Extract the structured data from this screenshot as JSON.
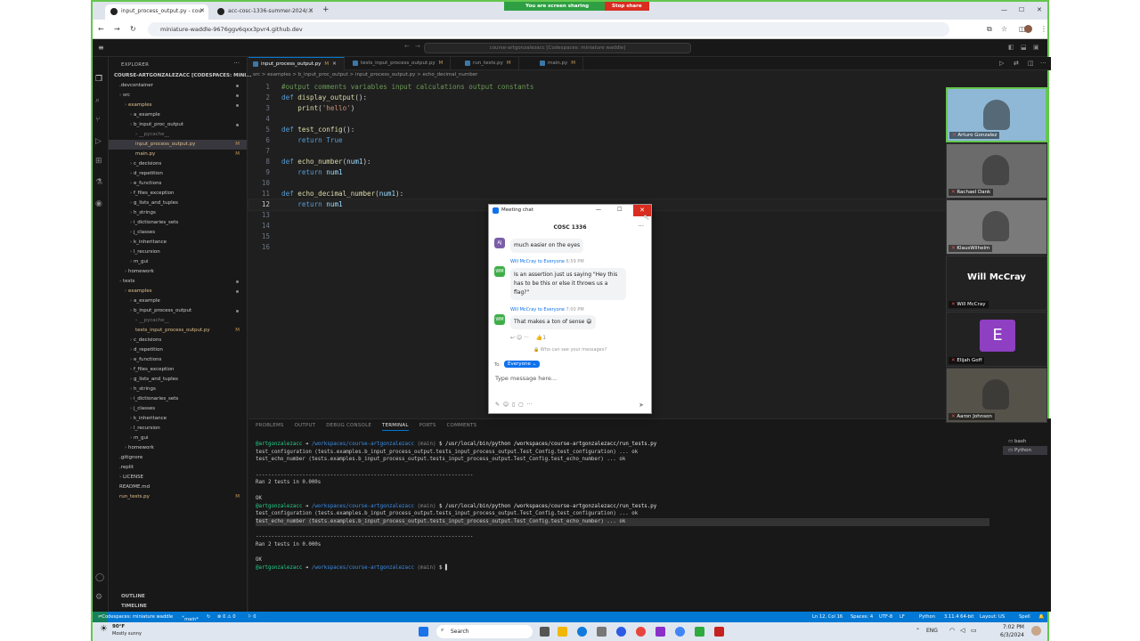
{
  "browser": {
    "tabs": [
      {
        "label": "input_process_output.py - cou",
        "active": true
      },
      {
        "label": "acc-cosc-1336-summer-2024/...",
        "active": false
      }
    ],
    "share_banner": "You are screen sharing",
    "stop_share": "Stop share",
    "url": "miniature-waddle-9676ggv6qxx3pvr4.github.dev"
  },
  "vscode": {
    "command_center": "course-artgonzalezacc [Codespaces: miniature waddle]",
    "explorer_title": "EXPLORER",
    "tree": [
      {
        "label": "COURSE-ARTGONZALEZACC [CODESPACES: MINI...",
        "indent": 0,
        "bold": true
      },
      {
        "label": ".devcontainer",
        "indent": 1,
        "dot": true
      },
      {
        "label": "src",
        "indent": 1,
        "dot": true
      },
      {
        "label": "examples",
        "indent": 2,
        "dot": true,
        "color": "#e2c08d"
      },
      {
        "label": "a_example",
        "indent": 3
      },
      {
        "label": "b_input_proc_output",
        "indent": 3,
        "dot": true
      },
      {
        "label": "__pycache__",
        "indent": 4,
        "color": "#777"
      },
      {
        "label": "input_process_output.py",
        "indent": 4,
        "mark": "M",
        "selected": true,
        "color": "#e2c08d"
      },
      {
        "label": "main.py",
        "indent": 4,
        "mark": "M",
        "color": "#e2c08d"
      },
      {
        "label": "c_decisions",
        "indent": 3
      },
      {
        "label": "d_repetition",
        "indent": 3
      },
      {
        "label": "e_functions",
        "indent": 3
      },
      {
        "label": "f_files_exception",
        "indent": 3
      },
      {
        "label": "g_lists_and_tuples",
        "indent": 3
      },
      {
        "label": "h_strings",
        "indent": 3
      },
      {
        "label": "i_dictionaries_sets",
        "indent": 3
      },
      {
        "label": "j_classes",
        "indent": 3
      },
      {
        "label": "k_inheritance",
        "indent": 3
      },
      {
        "label": "l_recursion",
        "indent": 3
      },
      {
        "label": "m_gui",
        "indent": 3
      },
      {
        "label": "homework",
        "indent": 2
      },
      {
        "label": "tests",
        "indent": 1,
        "dot": true
      },
      {
        "label": "examples",
        "indent": 2,
        "dot": true,
        "color": "#e2c08d"
      },
      {
        "label": "a_example",
        "indent": 3
      },
      {
        "label": "b_input_process_output",
        "indent": 3,
        "dot": true
      },
      {
        "label": "__pycache__",
        "indent": 4,
        "color": "#777"
      },
      {
        "label": "tests_input_process_output.py",
        "indent": 4,
        "mark": "M",
        "color": "#e2c08d"
      },
      {
        "label": "c_decisions",
        "indent": 3
      },
      {
        "label": "d_repetition",
        "indent": 3
      },
      {
        "label": "e_functions",
        "indent": 3
      },
      {
        "label": "f_files_exception",
        "indent": 3
      },
      {
        "label": "g_lists_and_tuples",
        "indent": 3
      },
      {
        "label": "h_strings",
        "indent": 3
      },
      {
        "label": "i_dictionaries_sets",
        "indent": 3
      },
      {
        "label": "j_classes",
        "indent": 3
      },
      {
        "label": "k_inheritance",
        "indent": 3
      },
      {
        "label": "l_recursion",
        "indent": 3
      },
      {
        "label": "m_gui",
        "indent": 3
      },
      {
        "label": "homework",
        "indent": 2
      },
      {
        "label": ".gitignore",
        "indent": 1
      },
      {
        "label": ".replit",
        "indent": 1
      },
      {
        "label": "LICENSE",
        "indent": 1
      },
      {
        "label": "README.md",
        "indent": 1
      },
      {
        "label": "run_tests.py",
        "indent": 1,
        "mark": "M",
        "color": "#e2c08d"
      }
    ],
    "outline_label": "OUTLINE",
    "timeline_label": "TIMELINE",
    "editor_tabs": [
      {
        "label": "input_process_output.py",
        "mark": "M",
        "active": true
      },
      {
        "label": "tests_input_process_output.py",
        "mark": "M"
      },
      {
        "label": "run_tests.py",
        "mark": "M"
      },
      {
        "label": "main.py",
        "mark": "M"
      }
    ],
    "breadcrumb": "src > examples > b_input_proc_output > input_process_output.py > echo_decimal_number",
    "code_lines": [
      [
        {
          "t": "#output comments variables input calculations output constants",
          "c": "cm"
        }
      ],
      [
        {
          "t": "def ",
          "c": "kw"
        },
        {
          "t": "display_output",
          "c": "fn"
        },
        {
          "t": "():",
          "c": ""
        }
      ],
      [
        {
          "t": "    print",
          "c": "bi"
        },
        {
          "t": "(",
          "c": ""
        },
        {
          "t": "'hello'",
          "c": "st"
        },
        {
          "t": ")",
          "c": ""
        }
      ],
      [],
      [
        {
          "t": "def ",
          "c": "kw"
        },
        {
          "t": "test_config",
          "c": "fn"
        },
        {
          "t": "():",
          "c": ""
        }
      ],
      [
        {
          "t": "    return ",
          "c": "kw"
        },
        {
          "t": "True",
          "c": "ct"
        }
      ],
      [],
      [
        {
          "t": "def ",
          "c": "kw"
        },
        {
          "t": "echo_number",
          "c": "fn"
        },
        {
          "t": "(",
          "c": ""
        },
        {
          "t": "num1",
          "c": "pa"
        },
        {
          "t": "):",
          "c": ""
        }
      ],
      [
        {
          "t": "    return ",
          "c": "kw"
        },
        {
          "t": "num1",
          "c": "pa"
        }
      ],
      [],
      [
        {
          "t": "def ",
          "c": "kw"
        },
        {
          "t": "echo_decimal_number",
          "c": "fn"
        },
        {
          "t": "(",
          "c": ""
        },
        {
          "t": "num1",
          "c": "pa"
        },
        {
          "t": "):",
          "c": ""
        }
      ],
      [
        {
          "t": "    return ",
          "c": "kw"
        },
        {
          "t": "num1",
          "c": "pa"
        }
      ],
      [],
      [],
      [],
      []
    ],
    "current_line": 12,
    "panel_tabs": [
      "PROBLEMS",
      "OUTPUT",
      "DEBUG CONSOLE",
      "TERMINAL",
      "PORTS",
      "COMMENTS"
    ],
    "active_panel_tab": "TERMINAL",
    "terminal_lines": [
      {
        "type": "prompt",
        "user": "@artgonzalezacc",
        "path": "/workspaces/course-artgonzalezacc",
        "branch": "(main)",
        "cmd": "$ /usr/local/bin/python /workspaces/course-artgonzalezacc/run_tests.py"
      },
      {
        "type": "text",
        "text": "test_configuration (tests.examples.b_input_process_output.tests_input_process_output.Test_Config.test_configuration) ... ok"
      },
      {
        "type": "text",
        "text": "test_echo_number (tests.examples.b_input_process_output.tests_input_process_output.Test_Config.test_echo_number) ... ok"
      },
      {
        "type": "text",
        "text": ""
      },
      {
        "type": "text",
        "text": "----------------------------------------------------------------------"
      },
      {
        "type": "text",
        "text": "Ran 2 tests in 0.000s"
      },
      {
        "type": "text",
        "text": ""
      },
      {
        "type": "text",
        "text": "OK"
      },
      {
        "type": "prompt",
        "user": "@artgonzalezacc",
        "path": "/workspaces/course-artgonzalezacc",
        "branch": "(main)",
        "cmd": "$ /usr/local/bin/python /workspaces/course-artgonzalezacc/run_tests.py"
      },
      {
        "type": "text",
        "text": "test_configuration (tests.examples.b_input_process_output.tests_input_process_output.Test_Config.test_configuration) ... ok"
      },
      {
        "type": "text",
        "text": "test_echo_number (tests.examples.b_input_process_output.tests_input_process_output.Test_Config.test_echo_number) ... ok",
        "highlight": true
      },
      {
        "type": "text",
        "text": ""
      },
      {
        "type": "text",
        "text": "----------------------------------------------------------------------"
      },
      {
        "type": "text",
        "text": "Ran 2 tests in 0.000s"
      },
      {
        "type": "text",
        "text": ""
      },
      {
        "type": "text",
        "text": "OK"
      },
      {
        "type": "prompt",
        "user": "@artgonzalezacc",
        "path": "/workspaces/course-artgonzalezacc",
        "branch": "(main)",
        "cmd": "$ ▌"
      }
    ],
    "terminal_sessions": [
      "bash",
      "Python"
    ],
    "status_bar": {
      "remote": "Codespaces: miniature waddle",
      "branch": "main*",
      "problems": "⊗ 0 ⚠ 0",
      "ports": "⚐ 0",
      "position": "Ln 12, Col 16",
      "spaces": "Spaces: 4",
      "encoding": "UTF-8",
      "eol": "LF",
      "language": "Python",
      "interpreter": "3.11.4 64-bit",
      "layout": "Layout: US",
      "spell": "Spell"
    }
  },
  "chat": {
    "window_title": "Meeting chat",
    "header": "COSC 1336",
    "messages": [
      {
        "avatar": "AJ",
        "avatar_color": "#7b5ea7",
        "text": "much easier on the eyes"
      },
      {
        "avatar": "WM",
        "avatar_color": "#3fae49",
        "sender": "Will McCray",
        "to": "to Everyone",
        "time": "6:59 PM",
        "text": "Is an assertion just us saying \"Hey this has to be this or else it throws us a flag?\""
      },
      {
        "avatar": "WM",
        "avatar_color": "#3fae49",
        "sender": "Will McCray",
        "to": "to Everyone",
        "time": "7:00 PM",
        "text": "That makes a ton of sense 😄"
      }
    ],
    "reaction_count": "1",
    "privacy_note": "Who can see your messages?",
    "to_label": "To:",
    "recipient": "Everyone",
    "input_placeholder": "Type message here..."
  },
  "participants": [
    {
      "name": "Arturo Gonzalez",
      "type": "video",
      "bg": "#8fb8d6"
    },
    {
      "name": "Rachael Dank",
      "type": "video",
      "bg": "#6b6b6b"
    },
    {
      "name": "KlausWilhelm",
      "type": "video",
      "bg": "#7a7a7a"
    },
    {
      "name": "Will McCray",
      "type": "name",
      "big": "Will McCray"
    },
    {
      "name": "Elijah Goff",
      "type": "avatar",
      "letter": "E",
      "color": "#8e3fc2"
    },
    {
      "name": "Aaron Johnson",
      "type": "video",
      "bg": "#55524a"
    }
  ],
  "taskbar": {
    "weather_temp": "90°F",
    "weather_desc": "Mostly sunny",
    "search": "Search",
    "lang": "ENG",
    "time": "7:02 PM",
    "date": "6/3/2024"
  }
}
